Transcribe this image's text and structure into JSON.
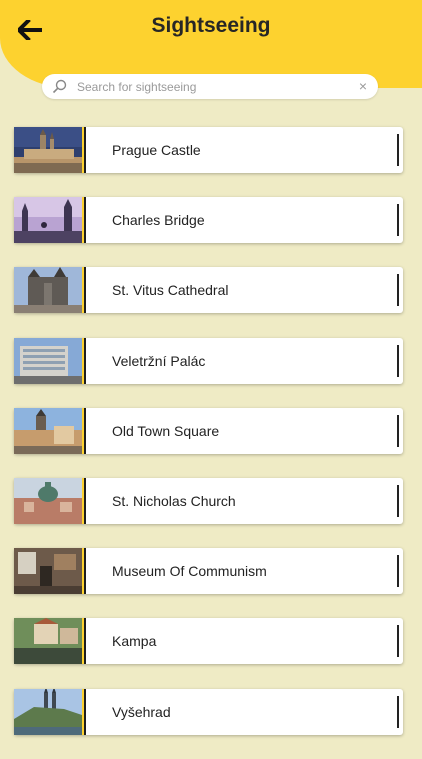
{
  "header": {
    "title": "Sightseeing",
    "color": "#FDD22F",
    "back_icon": "back-arrow-icon"
  },
  "search": {
    "placeholder": "Search for sightseeing",
    "value": "",
    "icon": "search-icon",
    "clear_icon": "close-icon"
  },
  "colors": {
    "background": "#EFEBC5",
    "accent": "#FDD22F"
  },
  "places": [
    {
      "name": "Prague Castle",
      "thumb": "castle"
    },
    {
      "name": "Charles Bridge",
      "thumb": "bridge"
    },
    {
      "name": "St. Vitus Cathedral",
      "thumb": "cathedral"
    },
    {
      "name": "Veletržní Palác",
      "thumb": "modern-building"
    },
    {
      "name": "Old Town Square",
      "thumb": "square"
    },
    {
      "name": "St. Nicholas Church",
      "thumb": "church"
    },
    {
      "name": "Museum Of Communism",
      "thumb": "museum-interior"
    },
    {
      "name": "Kampa",
      "thumb": "river-houses"
    },
    {
      "name": "Vyšehrad",
      "thumb": "hill-fortress"
    }
  ]
}
